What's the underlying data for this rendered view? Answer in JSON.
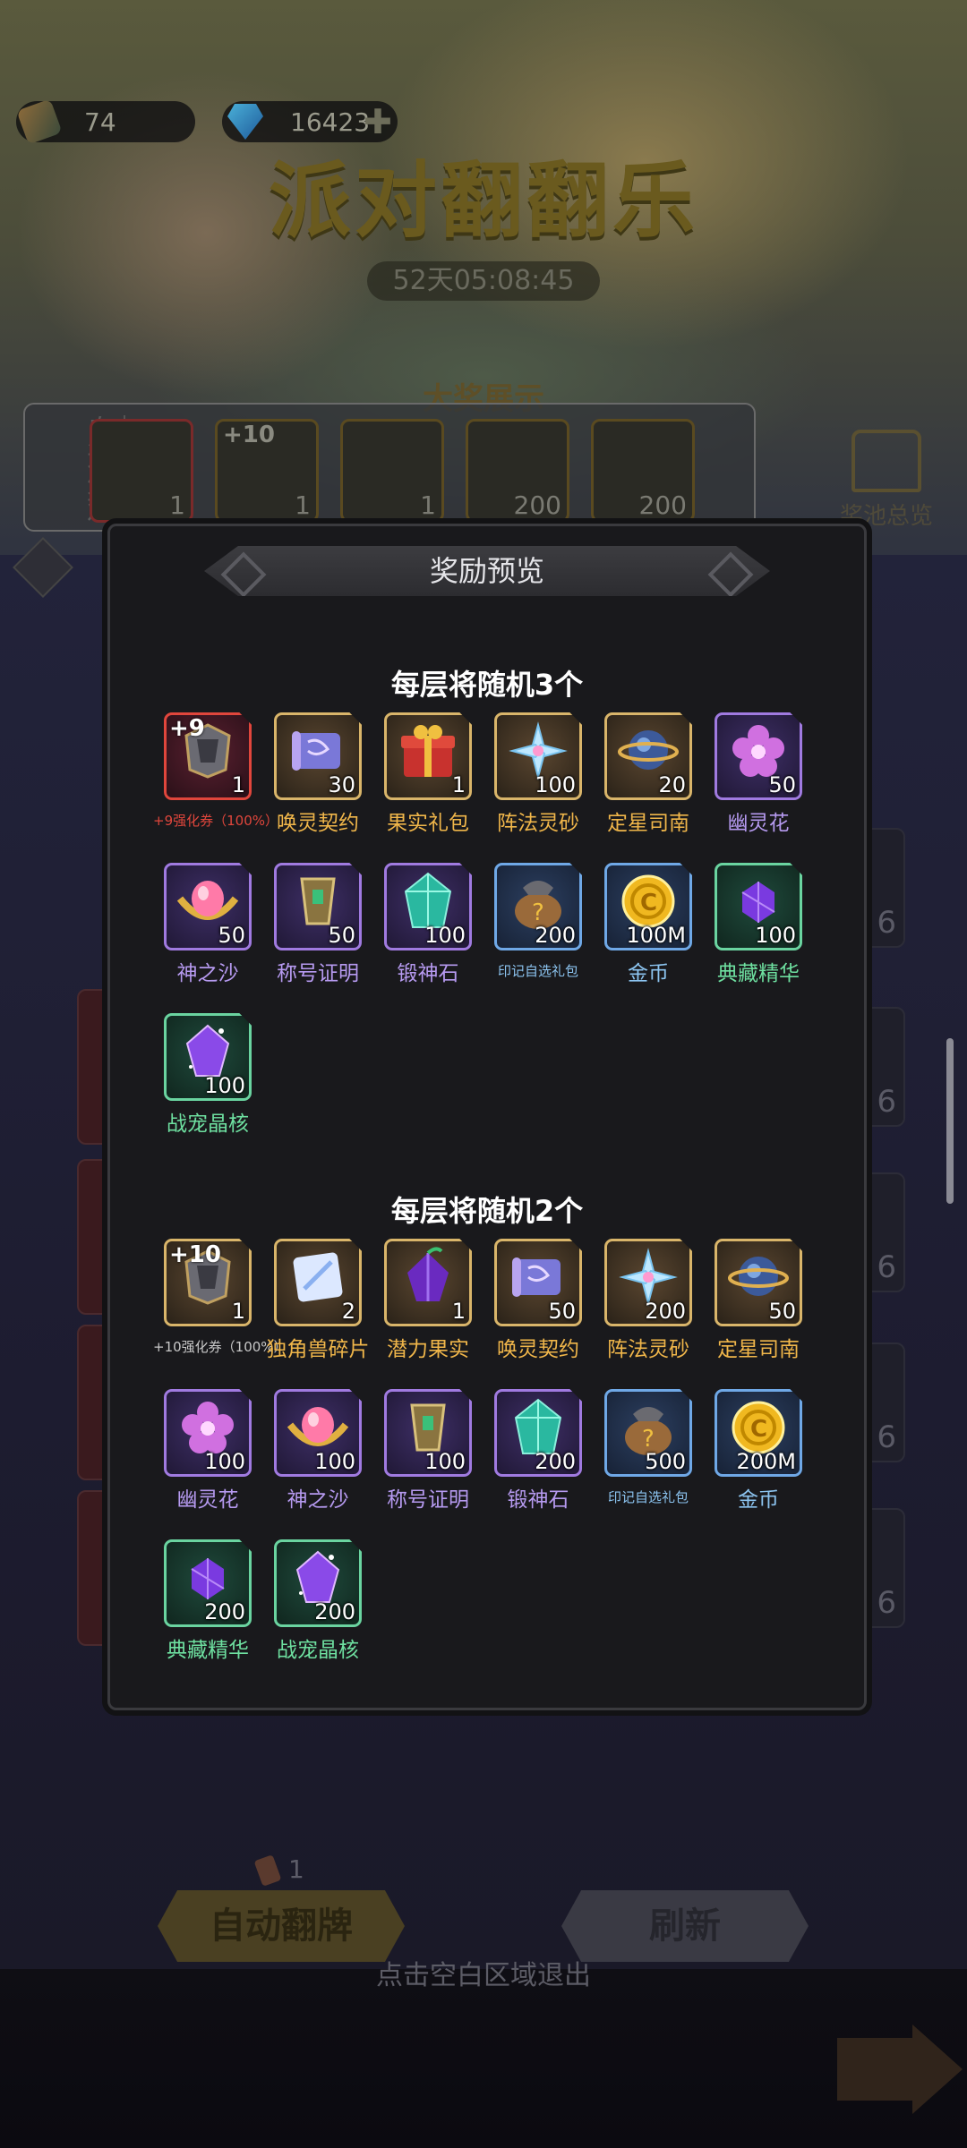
{
  "currency": {
    "tickets": "74",
    "diamonds": "16423"
  },
  "event": {
    "title": "派对翻翻乐",
    "timer": "52天05:08:45"
  },
  "showcase": {
    "title": "大奖展示",
    "side_label": "自选外观",
    "items": [
      {
        "count": "1"
      },
      {
        "plus": "+10",
        "count": "1"
      },
      {
        "count": "1"
      },
      {
        "count": "200"
      },
      {
        "count": "200"
      }
    ]
  },
  "pool_overview": "奖池总览",
  "side_tiles": [
    "6",
    "6",
    "6",
    "6",
    "6"
  ],
  "modal": {
    "title": "奖励预览",
    "section1": {
      "title": "每层将随机3个",
      "items": [
        {
          "name": "+9强化券（100%）",
          "count": "1",
          "plus": "+9",
          "rarity": "red",
          "icon": "enhance-ticket-icon"
        },
        {
          "name": "唤灵契约",
          "count": "30",
          "rarity": "gold",
          "icon": "scroll-icon"
        },
        {
          "name": "果实礼包",
          "count": "1",
          "rarity": "gold",
          "icon": "gift-box-icon"
        },
        {
          "name": "阵法灵砂",
          "count": "100",
          "rarity": "gold",
          "icon": "crystal-flower-icon"
        },
        {
          "name": "定星司南",
          "count": "20",
          "rarity": "gold",
          "icon": "compass-orb-icon"
        },
        {
          "name": "幽灵花",
          "count": "50",
          "rarity": "purple",
          "icon": "ghost-flower-icon"
        },
        {
          "name": "神之沙",
          "count": "50",
          "rarity": "purple",
          "icon": "divine-sand-icon"
        },
        {
          "name": "称号证明",
          "count": "50",
          "rarity": "purple",
          "icon": "title-badge-icon"
        },
        {
          "name": "锻神石",
          "count": "100",
          "rarity": "purple",
          "icon": "forge-stone-icon"
        },
        {
          "name": "印记自选礼包",
          "count": "200",
          "rarity": "blue",
          "icon": "mystery-bag-icon"
        },
        {
          "name": "金币",
          "count": "100M",
          "rarity": "blue",
          "icon": "gold-coin-icon"
        },
        {
          "name": "典藏精华",
          "count": "100",
          "rarity": "green",
          "icon": "essence-icon"
        },
        {
          "name": "战宠晶核",
          "count": "100",
          "rarity": "green",
          "icon": "pet-crystal-icon"
        }
      ]
    },
    "section2": {
      "title": "每层将随机2个",
      "items": [
        {
          "name": "+10强化券（100%）",
          "count": "1",
          "plus": "+10",
          "rarity": "gold",
          "icon": "enhance-ticket-icon"
        },
        {
          "name": "独角兽碎片",
          "count": "2",
          "rarity": "gold",
          "icon": "unicorn-shard-icon"
        },
        {
          "name": "潜力果实",
          "count": "1",
          "rarity": "gold",
          "icon": "potential-fruit-icon"
        },
        {
          "name": "唤灵契约",
          "count": "50",
          "rarity": "gold",
          "icon": "scroll-icon"
        },
        {
          "name": "阵法灵砂",
          "count": "200",
          "rarity": "gold",
          "icon": "crystal-flower-icon"
        },
        {
          "name": "定星司南",
          "count": "50",
          "rarity": "gold",
          "icon": "compass-orb-icon"
        },
        {
          "name": "幽灵花",
          "count": "100",
          "rarity": "purple",
          "icon": "ghost-flower-icon"
        },
        {
          "name": "神之沙",
          "count": "100",
          "rarity": "purple",
          "icon": "divine-sand-icon"
        },
        {
          "name": "称号证明",
          "count": "100",
          "rarity": "purple",
          "icon": "title-badge-icon"
        },
        {
          "name": "锻神石",
          "count": "200",
          "rarity": "purple",
          "icon": "forge-stone-icon"
        },
        {
          "name": "印记自选礼包",
          "count": "500",
          "rarity": "blue",
          "icon": "mystery-bag-icon"
        },
        {
          "name": "金币",
          "count": "200M",
          "rarity": "blue",
          "icon": "gold-coin-icon"
        },
        {
          "name": "典藏精华",
          "count": "200",
          "rarity": "green",
          "icon": "essence-icon"
        },
        {
          "name": "战宠晶核",
          "count": "200",
          "rarity": "green",
          "icon": "pet-crystal-icon"
        }
      ]
    }
  },
  "footer": {
    "ticket_count": "1",
    "auto_flip": "自动翻牌",
    "refresh": "刷新",
    "exit_hint": "点击空白区域退出"
  },
  "colors": {
    "gold": "#f0b64a",
    "purple": "#b69af0",
    "blue": "#8cc4f0",
    "green": "#6ee0a0",
    "red": "#e0463c"
  }
}
